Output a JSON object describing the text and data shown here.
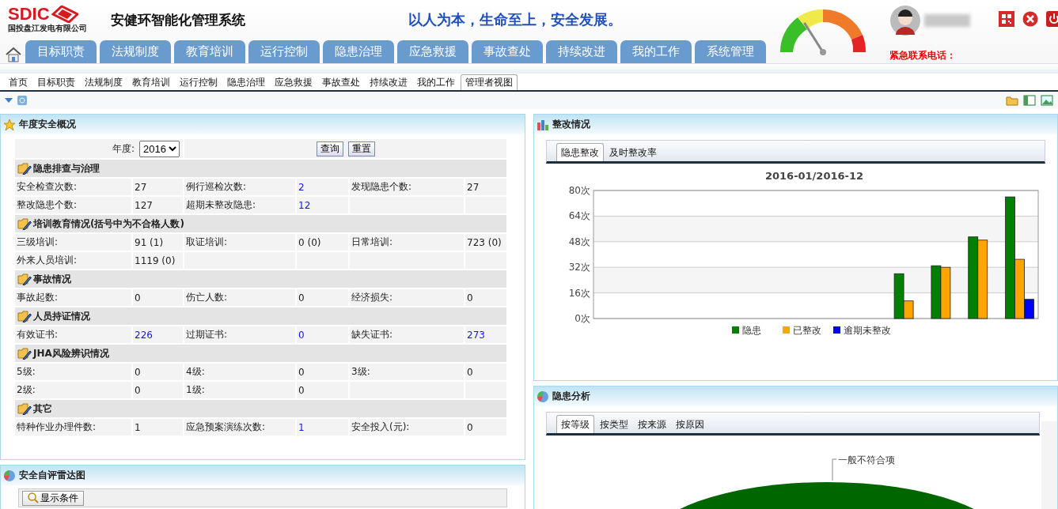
{
  "header": {
    "logo_text": "SDIC",
    "company_name": "国投盘江发电有限公司",
    "system_title": "安健环智能化管理系统",
    "slogan": "以人为本，生命至上，安全发展。",
    "emergency_label": "紧急联系电话："
  },
  "main_nav": [
    {
      "label": "目标职责"
    },
    {
      "label": "法规制度"
    },
    {
      "label": "教育培训"
    },
    {
      "label": "运行控制"
    },
    {
      "label": "隐患治理"
    },
    {
      "label": "应急救援"
    },
    {
      "label": "事故查处"
    },
    {
      "label": "持续改进"
    },
    {
      "label": "我的工作"
    },
    {
      "label": "系统管理"
    }
  ],
  "sub_tabs": [
    {
      "label": "首页",
      "selected": false
    },
    {
      "label": "目标职责",
      "selected": false
    },
    {
      "label": "法规制度",
      "selected": false
    },
    {
      "label": "教育培训",
      "selected": false
    },
    {
      "label": "运行控制",
      "selected": false
    },
    {
      "label": "隐患治理",
      "selected": false
    },
    {
      "label": "应急救援",
      "selected": false
    },
    {
      "label": "事故查处",
      "selected": false
    },
    {
      "label": "持续改进",
      "selected": false
    },
    {
      "label": "我的工作",
      "selected": false
    },
    {
      "label": "管理者视图",
      "selected": true
    }
  ],
  "annual_overview": {
    "title": "年度安全概况",
    "year_label": "年度:",
    "year_value": "2016",
    "buttons": [
      "查询",
      "重置"
    ],
    "sections": [
      {
        "title": "隐患排查与治理",
        "rows": [
          [
            {
              "label": "安全检查次数:",
              "value": "27",
              "link": false
            },
            {
              "label": "例行巡检次数:",
              "value": "2",
              "link": true
            },
            {
              "label": "发现隐患个数:",
              "value": "27",
              "link": false
            }
          ],
          [
            {
              "label": "整改隐患个数:",
              "value": "127",
              "link": false
            },
            {
              "label": "超期未整改隐患:",
              "value": "12",
              "link": true
            }
          ]
        ]
      },
      {
        "title": "培训教育情况(括号中为不合格人数)",
        "rows": [
          [
            {
              "label": "三级培训:",
              "value": "91 (1)",
              "link": false
            },
            {
              "label": "取证培训:",
              "value": "0 (0)",
              "link": false
            },
            {
              "label": "日常培训:",
              "value": "723 (0)",
              "link": false
            }
          ],
          [
            {
              "label": "外来人员培训:",
              "value": "1119 (0)",
              "link": false
            }
          ]
        ]
      },
      {
        "title": "事故情况",
        "rows": [
          [
            {
              "label": "事故起数:",
              "value": "0",
              "link": false
            },
            {
              "label": "伤亡人数:",
              "value": "0",
              "link": false
            },
            {
              "label": "经济损失:",
              "value": "0",
              "link": false
            }
          ]
        ]
      },
      {
        "title": "人员持证情况",
        "rows": [
          [
            {
              "label": "有效证书:",
              "value": "226",
              "link": true
            },
            {
              "label": "过期证书:",
              "value": "0",
              "link": true
            },
            {
              "label": "缺失证书:",
              "value": "273",
              "link": true
            }
          ]
        ]
      },
      {
        "title": "JHA风险辨识情况",
        "rows": [
          [
            {
              "label": "5级:",
              "value": "0",
              "link": false
            },
            {
              "label": "4级:",
              "value": "0",
              "link": false
            },
            {
              "label": "3级:",
              "value": "0",
              "link": false
            }
          ],
          [
            {
              "label": "2级:",
              "value": "0",
              "link": false
            },
            {
              "label": "1级:",
              "value": "0",
              "link": false
            }
          ]
        ]
      },
      {
        "title": "其它",
        "rows": [
          [
            {
              "label": "特种作业办理件数:",
              "value": "1",
              "link": false
            },
            {
              "label": "应急预案演练次数:",
              "value": "1",
              "link": true
            },
            {
              "label": "安全投入(元):",
              "value": "0",
              "link": false
            }
          ]
        ]
      }
    ]
  },
  "radar_panel": {
    "title": "安全自评雷达图",
    "button": "显示条件"
  },
  "rectification_panel": {
    "title": "整改情况",
    "tabs": [
      {
        "label": "隐患整改",
        "selected": true
      },
      {
        "label": "及时整改率",
        "selected": false
      }
    ],
    "chart_data": {
      "type": "bar",
      "title": "2016-01/2016-12",
      "grid": true,
      "legend": "bottom",
      "ylim": [
        0,
        80
      ],
      "yticks": [
        {
          "value": 0,
          "label": "0次"
        },
        {
          "value": 16,
          "label": "16次"
        },
        {
          "value": 32,
          "label": "32次"
        },
        {
          "value": 48,
          "label": "48次"
        },
        {
          "value": 64,
          "label": "64次"
        },
        {
          "value": 80,
          "label": "80次"
        }
      ],
      "series": [
        {
          "name": "隐患",
          "color": "#008000",
          "values": [
            null,
            null,
            null,
            null,
            null,
            null,
            null,
            null,
            28,
            33,
            51,
            76
          ]
        },
        {
          "name": "已整改",
          "color": "#ffa500",
          "values": [
            null,
            null,
            null,
            null,
            null,
            null,
            null,
            null,
            11,
            32,
            49,
            37
          ]
        },
        {
          "name": "逾期未整改",
          "color": "#0000ff",
          "values": [
            null,
            null,
            null,
            null,
            null,
            null,
            null,
            null,
            0,
            0,
            0,
            12
          ]
        }
      ]
    }
  },
  "analysis_panel": {
    "title": "隐患分析",
    "tabs": [
      {
        "label": "按等级",
        "selected": true
      },
      {
        "label": "按类型",
        "selected": false
      },
      {
        "label": "按来源",
        "selected": false
      },
      {
        "label": "按原因",
        "selected": false
      }
    ],
    "pie_label": "一般不符合项"
  }
}
